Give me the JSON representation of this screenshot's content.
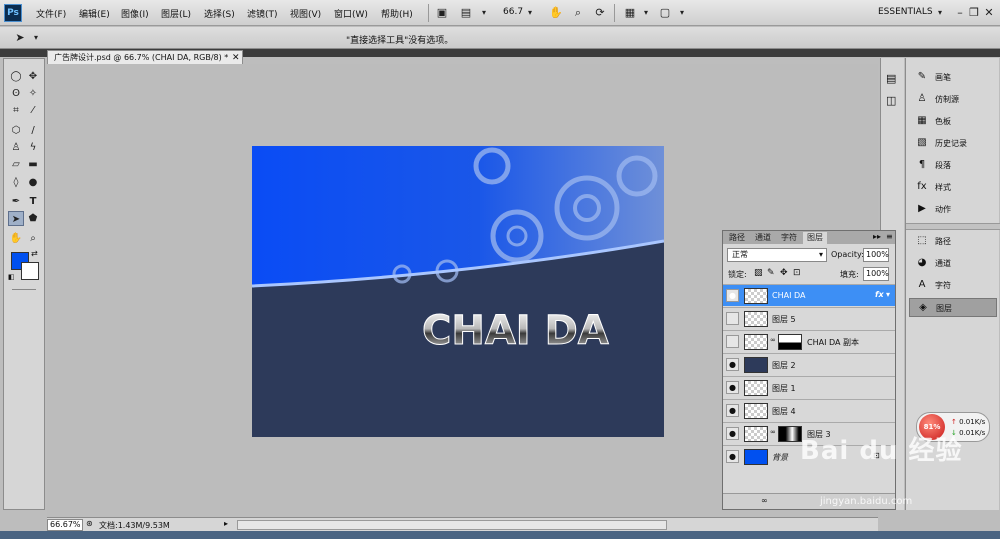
{
  "app": {
    "logo": "Ps",
    "workspace": "ESSENTIALS"
  },
  "menu": [
    "文件(F)",
    "编辑(E)",
    "图像(I)",
    "图层(L)",
    "选择(S)",
    "滤镜(T)",
    "视图(V)",
    "窗口(W)",
    "帮助(H)"
  ],
  "zoom_value": "66.7",
  "options_bar": {
    "hint": "\"直接选择工具\"没有选项。"
  },
  "document": {
    "tab_title": "广告牌设计.psd @ 66.7% (CHAI DA, RGB/8) *",
    "canvas_text": "CHAI DA",
    "colors": {
      "top": "#0a4cf5",
      "bottom": "#2d3a5a",
      "arc": "#8fb7ff"
    }
  },
  "status": {
    "zoom": "66.67%",
    "doc_info": "文档:1.43M/9.53M"
  },
  "colors": {
    "foreground": "#0050f0",
    "background": "#ffffff",
    "selection": "#3d8ff5"
  },
  "dock": [
    {
      "label": "画笔",
      "icon": "brush-icon"
    },
    {
      "label": "仿制源",
      "icon": "clone-source-icon"
    },
    {
      "label": "色板",
      "icon": "swatches-icon"
    },
    {
      "label": "历史记录",
      "icon": "history-icon"
    },
    {
      "label": "段落",
      "icon": "paragraph-icon"
    },
    {
      "label": "样式",
      "icon": "styles-icon"
    },
    {
      "label": "动作",
      "icon": "actions-icon"
    },
    {
      "label": "路径",
      "icon": "paths-icon"
    },
    {
      "label": "通道",
      "icon": "channels-icon"
    },
    {
      "label": "字符",
      "icon": "character-icon"
    },
    {
      "label": "图层",
      "icon": "layers-icon"
    }
  ],
  "layers_panel": {
    "tabs": [
      "路径",
      "通道",
      "字符",
      "图层"
    ],
    "blend_mode": "正常",
    "opacity_label": "Opacity:",
    "opacity": "100%",
    "lock_label": "锁定:",
    "fill_label": "填充:",
    "fill": "100%",
    "layers": [
      {
        "name": "CHAI DA",
        "visible": true,
        "selected": true,
        "fx": "fx"
      },
      {
        "name": "图层 5",
        "visible": false
      },
      {
        "name": "CHAI DA 副本",
        "visible": false,
        "mask": true
      },
      {
        "name": "图层 2",
        "visible": true
      },
      {
        "name": "图层 1",
        "visible": true
      },
      {
        "name": "图层 4",
        "visible": true
      },
      {
        "name": "图层 3",
        "visible": true,
        "mask": true
      },
      {
        "name": "背景",
        "visible": true,
        "locked": true
      }
    ]
  },
  "net_widget": {
    "percent": "81%",
    "up": "0.01K/s",
    "down": "0.01K/s"
  },
  "watermark": {
    "brand": "Bai du 经验",
    "url": "jingyan.baidu.com"
  }
}
